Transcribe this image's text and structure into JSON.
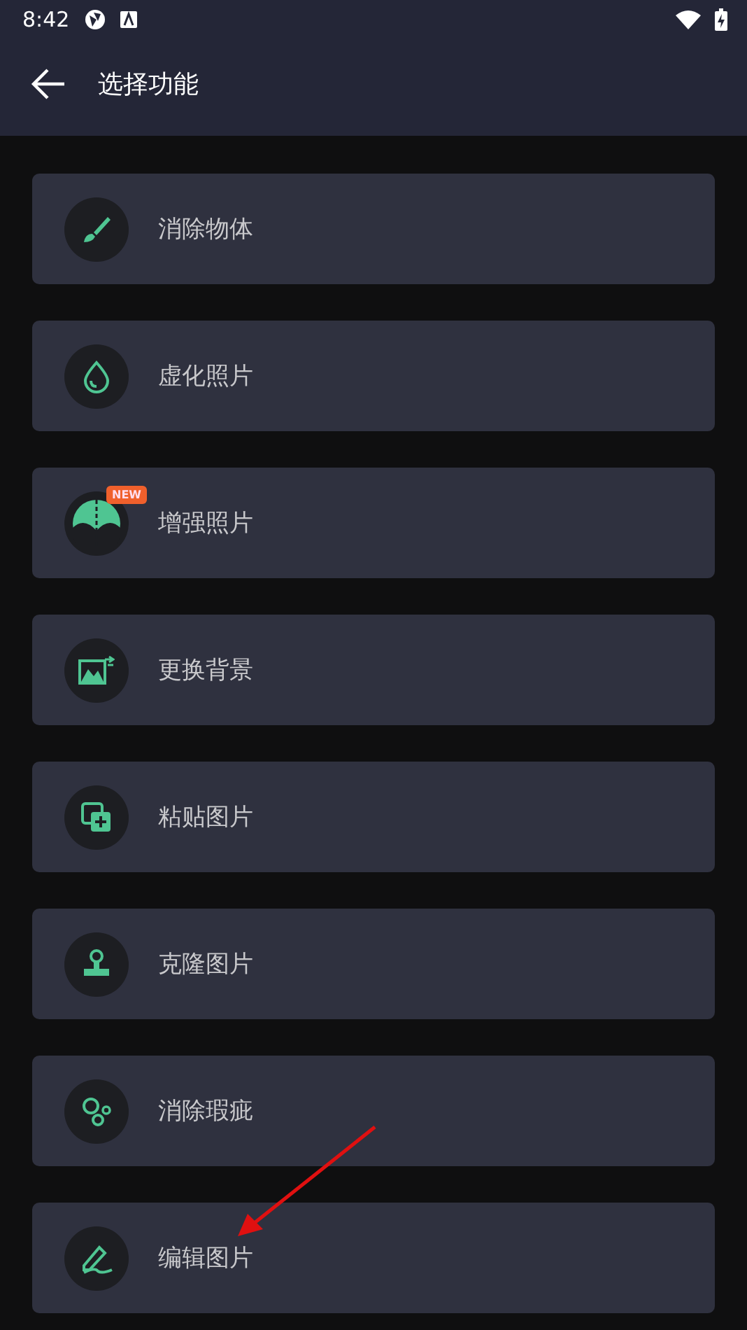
{
  "status_bar": {
    "time": "8:42"
  },
  "header": {
    "title": "选择功能"
  },
  "items": [
    {
      "label": "消除物体"
    },
    {
      "label": "虚化照片"
    },
    {
      "label": "增强照片",
      "badge": "NEW"
    },
    {
      "label": "更换背景"
    },
    {
      "label": "粘贴图片"
    },
    {
      "label": "克隆图片"
    },
    {
      "label": "消除瑕疵"
    },
    {
      "label": "编辑图片"
    }
  ]
}
